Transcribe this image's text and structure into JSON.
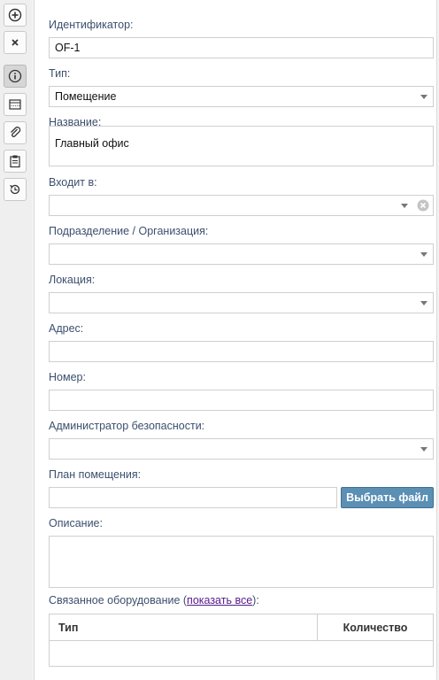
{
  "toolbar": {
    "buttons": [
      {
        "name": "add",
        "icon": "plus-circle-icon"
      },
      {
        "name": "close",
        "icon": "close-icon"
      },
      {
        "name": "info",
        "icon": "info-icon",
        "active": true
      },
      {
        "name": "table",
        "icon": "table-icon"
      },
      {
        "name": "attach",
        "icon": "paperclip-icon"
      },
      {
        "name": "clipboard",
        "icon": "clipboard-icon"
      },
      {
        "name": "history",
        "icon": "history-icon"
      }
    ]
  },
  "form": {
    "identifier": {
      "label": "Идентификатор:",
      "value": "OF-1"
    },
    "type": {
      "label": "Тип:",
      "value": "Помещение"
    },
    "name": {
      "label": "Название:",
      "value": "Главный офис"
    },
    "parent": {
      "label": "Входит в:",
      "value": ""
    },
    "department": {
      "label": "Подразделение / Организация:",
      "value": ""
    },
    "location": {
      "label": "Локация:",
      "value": ""
    },
    "address": {
      "label": "Адрес:",
      "value": ""
    },
    "number": {
      "label": "Номер:",
      "value": ""
    },
    "security_admin": {
      "label": "Администратор безопасности:",
      "value": ""
    },
    "room_plan": {
      "label": "План помещения:",
      "value": "",
      "button": "Выбрать файл"
    },
    "description": {
      "label": "Описание:",
      "value": ""
    },
    "related": {
      "label_prefix": "Связанное оборудование (",
      "link": "показать все",
      "label_suffix": "):",
      "columns": [
        "Тип",
        "Количество"
      ]
    }
  },
  "colors": {
    "label": "#3b4f6e",
    "button": "#5b8fb4",
    "link": "#551a8b"
  }
}
